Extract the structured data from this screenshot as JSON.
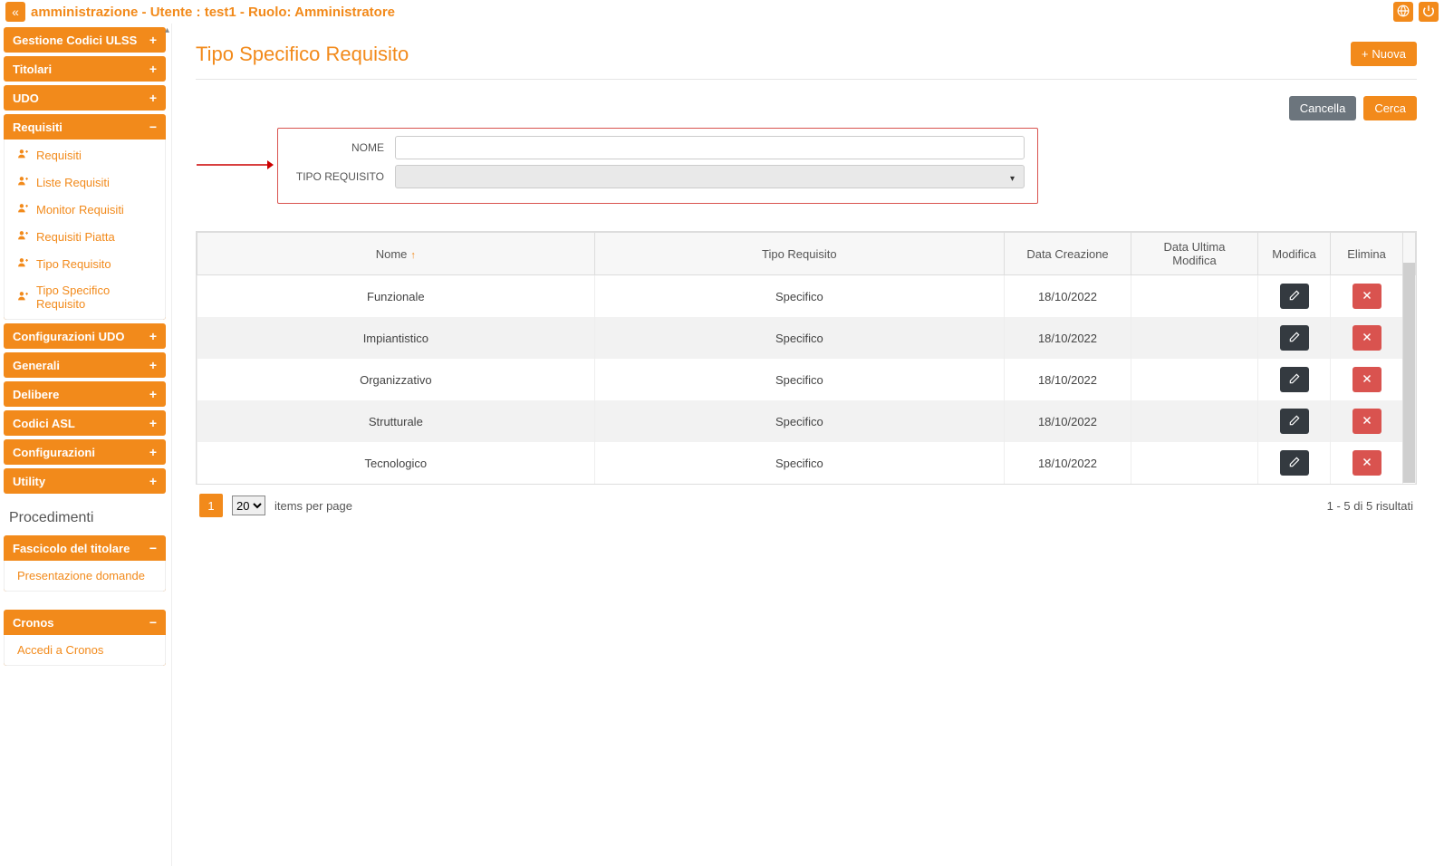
{
  "header": {
    "title": "amministrazione - Utente : test1 - Ruolo: Amministratore"
  },
  "sidebar": {
    "groups": [
      {
        "label": "Gestione Codici ULSS",
        "expanded": false
      },
      {
        "label": "Titolari",
        "expanded": false
      },
      {
        "label": "UDO",
        "expanded": false
      },
      {
        "label": "Requisiti",
        "expanded": true,
        "items": [
          {
            "label": "Requisiti"
          },
          {
            "label": "Liste Requisiti"
          },
          {
            "label": "Monitor Requisiti"
          },
          {
            "label": "Requisiti Piatta"
          },
          {
            "label": "Tipo Requisito"
          },
          {
            "label": "Tipo Specifico Requisito"
          }
        ]
      },
      {
        "label": "Configurazioni UDO",
        "expanded": false
      },
      {
        "label": "Generali",
        "expanded": false
      },
      {
        "label": "Delibere",
        "expanded": false
      },
      {
        "label": "Codici ASL",
        "expanded": false
      },
      {
        "label": "Configurazioni",
        "expanded": false
      },
      {
        "label": "Utility",
        "expanded": false
      }
    ],
    "section2_title": "Procedimenti",
    "groups2": [
      {
        "label": "Fascicolo del titolare",
        "expanded": true,
        "items": [
          {
            "label": "Presentazione domande"
          }
        ]
      },
      {
        "label": "Cronos",
        "expanded": true,
        "items": [
          {
            "label": "Accedi a Cronos"
          }
        ]
      }
    ]
  },
  "page": {
    "title": "Tipo Specifico Requisito",
    "new_button": "Nuova",
    "cancel_button": "Cancella",
    "search_button": "Cerca"
  },
  "search": {
    "field_nome_label": "NOME",
    "field_tipo_label": "TIPO REQUISITO",
    "nome_value": "",
    "tipo_value": ""
  },
  "table": {
    "columns": [
      "Nome",
      "Tipo Requisito",
      "Data Creazione",
      "Data Ultima Modifica",
      "Modifica",
      "Elimina"
    ],
    "sort_column": "Nome",
    "sort_dir": "asc",
    "rows": [
      {
        "nome": "Funzionale",
        "tipo": "Specifico",
        "data_creazione": "18/10/2022",
        "data_modifica": ""
      },
      {
        "nome": "Impiantistico",
        "tipo": "Specifico",
        "data_creazione": "18/10/2022",
        "data_modifica": ""
      },
      {
        "nome": "Organizzativo",
        "tipo": "Specifico",
        "data_creazione": "18/10/2022",
        "data_modifica": ""
      },
      {
        "nome": "Strutturale",
        "tipo": "Specifico",
        "data_creazione": "18/10/2022",
        "data_modifica": ""
      },
      {
        "nome": "Tecnologico",
        "tipo": "Specifico",
        "data_creazione": "18/10/2022",
        "data_modifica": ""
      }
    ]
  },
  "pager": {
    "current_page": "1",
    "page_size": "20",
    "page_size_label": "items per page",
    "summary": "1 - 5 di 5 risultati"
  }
}
